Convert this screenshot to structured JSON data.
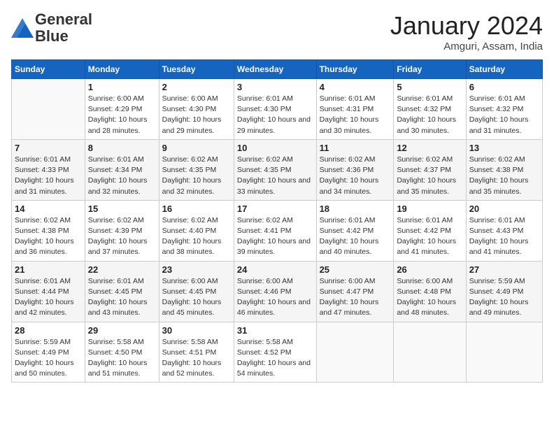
{
  "header": {
    "logo_general": "General",
    "logo_blue": "Blue",
    "month_title": "January 2024",
    "location": "Amguri, Assam, India"
  },
  "days_of_week": [
    "Sunday",
    "Monday",
    "Tuesday",
    "Wednesday",
    "Thursday",
    "Friday",
    "Saturday"
  ],
  "weeks": [
    [
      {
        "num": "",
        "sunrise": "",
        "sunset": "",
        "daylight": ""
      },
      {
        "num": "1",
        "sunrise": "Sunrise: 6:00 AM",
        "sunset": "Sunset: 4:29 PM",
        "daylight": "Daylight: 10 hours and 28 minutes."
      },
      {
        "num": "2",
        "sunrise": "Sunrise: 6:00 AM",
        "sunset": "Sunset: 4:30 PM",
        "daylight": "Daylight: 10 hours and 29 minutes."
      },
      {
        "num": "3",
        "sunrise": "Sunrise: 6:01 AM",
        "sunset": "Sunset: 4:30 PM",
        "daylight": "Daylight: 10 hours and 29 minutes."
      },
      {
        "num": "4",
        "sunrise": "Sunrise: 6:01 AM",
        "sunset": "Sunset: 4:31 PM",
        "daylight": "Daylight: 10 hours and 30 minutes."
      },
      {
        "num": "5",
        "sunrise": "Sunrise: 6:01 AM",
        "sunset": "Sunset: 4:32 PM",
        "daylight": "Daylight: 10 hours and 30 minutes."
      },
      {
        "num": "6",
        "sunrise": "Sunrise: 6:01 AM",
        "sunset": "Sunset: 4:32 PM",
        "daylight": "Daylight: 10 hours and 31 minutes."
      }
    ],
    [
      {
        "num": "7",
        "sunrise": "Sunrise: 6:01 AM",
        "sunset": "Sunset: 4:33 PM",
        "daylight": "Daylight: 10 hours and 31 minutes."
      },
      {
        "num": "8",
        "sunrise": "Sunrise: 6:01 AM",
        "sunset": "Sunset: 4:34 PM",
        "daylight": "Daylight: 10 hours and 32 minutes."
      },
      {
        "num": "9",
        "sunrise": "Sunrise: 6:02 AM",
        "sunset": "Sunset: 4:35 PM",
        "daylight": "Daylight: 10 hours and 32 minutes."
      },
      {
        "num": "10",
        "sunrise": "Sunrise: 6:02 AM",
        "sunset": "Sunset: 4:35 PM",
        "daylight": "Daylight: 10 hours and 33 minutes."
      },
      {
        "num": "11",
        "sunrise": "Sunrise: 6:02 AM",
        "sunset": "Sunset: 4:36 PM",
        "daylight": "Daylight: 10 hours and 34 minutes."
      },
      {
        "num": "12",
        "sunrise": "Sunrise: 6:02 AM",
        "sunset": "Sunset: 4:37 PM",
        "daylight": "Daylight: 10 hours and 35 minutes."
      },
      {
        "num": "13",
        "sunrise": "Sunrise: 6:02 AM",
        "sunset": "Sunset: 4:38 PM",
        "daylight": "Daylight: 10 hours and 35 minutes."
      }
    ],
    [
      {
        "num": "14",
        "sunrise": "Sunrise: 6:02 AM",
        "sunset": "Sunset: 4:38 PM",
        "daylight": "Daylight: 10 hours and 36 minutes."
      },
      {
        "num": "15",
        "sunrise": "Sunrise: 6:02 AM",
        "sunset": "Sunset: 4:39 PM",
        "daylight": "Daylight: 10 hours and 37 minutes."
      },
      {
        "num": "16",
        "sunrise": "Sunrise: 6:02 AM",
        "sunset": "Sunset: 4:40 PM",
        "daylight": "Daylight: 10 hours and 38 minutes."
      },
      {
        "num": "17",
        "sunrise": "Sunrise: 6:02 AM",
        "sunset": "Sunset: 4:41 PM",
        "daylight": "Daylight: 10 hours and 39 minutes."
      },
      {
        "num": "18",
        "sunrise": "Sunrise: 6:01 AM",
        "sunset": "Sunset: 4:42 PM",
        "daylight": "Daylight: 10 hours and 40 minutes."
      },
      {
        "num": "19",
        "sunrise": "Sunrise: 6:01 AM",
        "sunset": "Sunset: 4:42 PM",
        "daylight": "Daylight: 10 hours and 41 minutes."
      },
      {
        "num": "20",
        "sunrise": "Sunrise: 6:01 AM",
        "sunset": "Sunset: 4:43 PM",
        "daylight": "Daylight: 10 hours and 41 minutes."
      }
    ],
    [
      {
        "num": "21",
        "sunrise": "Sunrise: 6:01 AM",
        "sunset": "Sunset: 4:44 PM",
        "daylight": "Daylight: 10 hours and 42 minutes."
      },
      {
        "num": "22",
        "sunrise": "Sunrise: 6:01 AM",
        "sunset": "Sunset: 4:45 PM",
        "daylight": "Daylight: 10 hours and 43 minutes."
      },
      {
        "num": "23",
        "sunrise": "Sunrise: 6:00 AM",
        "sunset": "Sunset: 4:45 PM",
        "daylight": "Daylight: 10 hours and 45 minutes."
      },
      {
        "num": "24",
        "sunrise": "Sunrise: 6:00 AM",
        "sunset": "Sunset: 4:46 PM",
        "daylight": "Daylight: 10 hours and 46 minutes."
      },
      {
        "num": "25",
        "sunrise": "Sunrise: 6:00 AM",
        "sunset": "Sunset: 4:47 PM",
        "daylight": "Daylight: 10 hours and 47 minutes."
      },
      {
        "num": "26",
        "sunrise": "Sunrise: 6:00 AM",
        "sunset": "Sunset: 4:48 PM",
        "daylight": "Daylight: 10 hours and 48 minutes."
      },
      {
        "num": "27",
        "sunrise": "Sunrise: 5:59 AM",
        "sunset": "Sunset: 4:49 PM",
        "daylight": "Daylight: 10 hours and 49 minutes."
      }
    ],
    [
      {
        "num": "28",
        "sunrise": "Sunrise: 5:59 AM",
        "sunset": "Sunset: 4:49 PM",
        "daylight": "Daylight: 10 hours and 50 minutes."
      },
      {
        "num": "29",
        "sunrise": "Sunrise: 5:58 AM",
        "sunset": "Sunset: 4:50 PM",
        "daylight": "Daylight: 10 hours and 51 minutes."
      },
      {
        "num": "30",
        "sunrise": "Sunrise: 5:58 AM",
        "sunset": "Sunset: 4:51 PM",
        "daylight": "Daylight: 10 hours and 52 minutes."
      },
      {
        "num": "31",
        "sunrise": "Sunrise: 5:58 AM",
        "sunset": "Sunset: 4:52 PM",
        "daylight": "Daylight: 10 hours and 54 minutes."
      },
      {
        "num": "",
        "sunrise": "",
        "sunset": "",
        "daylight": ""
      },
      {
        "num": "",
        "sunrise": "",
        "sunset": "",
        "daylight": ""
      },
      {
        "num": "",
        "sunrise": "",
        "sunset": "",
        "daylight": ""
      }
    ]
  ]
}
